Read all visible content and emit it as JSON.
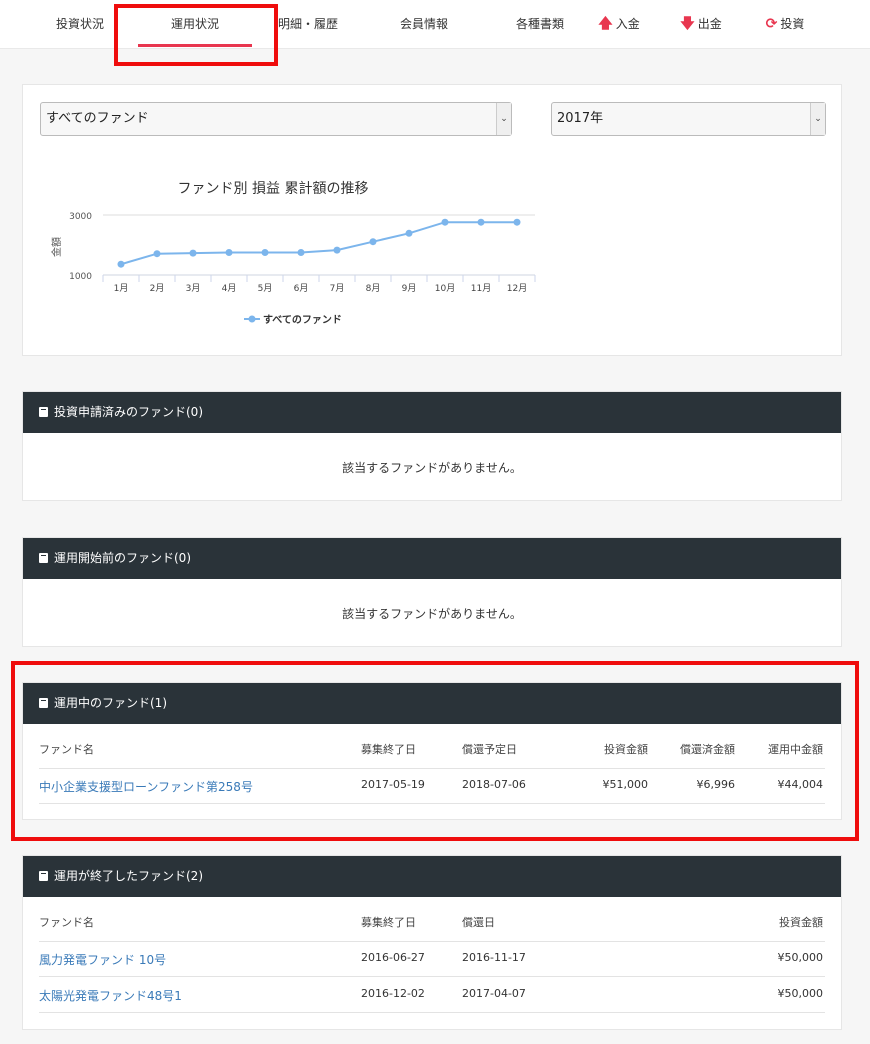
{
  "nav": {
    "items": [
      {
        "label": "投資状況"
      },
      {
        "label": "運用状況"
      },
      {
        "label": "明細・履歴"
      },
      {
        "label": "会員情報"
      },
      {
        "label": "各種書類"
      },
      {
        "label": "入金",
        "icon": "arrow-up-icon"
      },
      {
        "label": "出金",
        "icon": "arrow-down-icon"
      },
      {
        "label": "投資",
        "icon": "refresh-icon"
      }
    ],
    "active": "運用状況",
    "accent_color": "#e8364f",
    "icon_color": "#e8364f"
  },
  "filters": {
    "fund_select": "すべてのファンド",
    "year_select": "2017年"
  },
  "chart_data": {
    "type": "line",
    "title": "ファンド別 損益 累計額の推移",
    "ylabel": "金額",
    "ytick_labels": [
      "3000",
      "1000"
    ],
    "categories": [
      "1月",
      "2月",
      "3月",
      "4月",
      "5月",
      "6月",
      "7月",
      "8月",
      "9月",
      "10月",
      "11月",
      "12月"
    ],
    "series": [
      {
        "name": "すべてのファンド",
        "values": [
          1360,
          1710,
          1730,
          1750,
          1750,
          1750,
          1830,
          2110,
          2390,
          2760,
          2760,
          2760
        ],
        "color": "#7cb5ec"
      }
    ],
    "ylim": [
      1000,
      3000
    ],
    "grid": true,
    "legend": "bottom"
  },
  "sections": {
    "applied": {
      "title": "投資申請済みのファンド(0)",
      "empty": "該当するファンドがありません。"
    },
    "before": {
      "title": "運用開始前のファンド(0)",
      "empty": "該当するファンドがありません。"
    },
    "active": {
      "title": "運用中のファンド(1)",
      "headers": [
        "ファンド名",
        "募集終了日",
        "償還予定日",
        "投資金額",
        "償還済金額",
        "運用中金額"
      ],
      "rows": [
        [
          "中小企業支援型ローンファンド第258号",
          "2017-05-19",
          "2018-07-06",
          "¥51,000",
          "¥6,996",
          "¥44,004"
        ]
      ]
    },
    "ended": {
      "title": "運用が終了したファンド(2)",
      "headers": [
        "ファンド名",
        "募集終了日",
        "償還日",
        "投資金額"
      ],
      "rows": [
        [
          "風力発電ファンド 10号",
          "2016-06-27",
          "2016-11-17",
          "¥50,000"
        ],
        [
          "太陽光発電ファンド48号1",
          "2016-12-02",
          "2017-04-07",
          "¥50,000"
        ]
      ]
    }
  }
}
